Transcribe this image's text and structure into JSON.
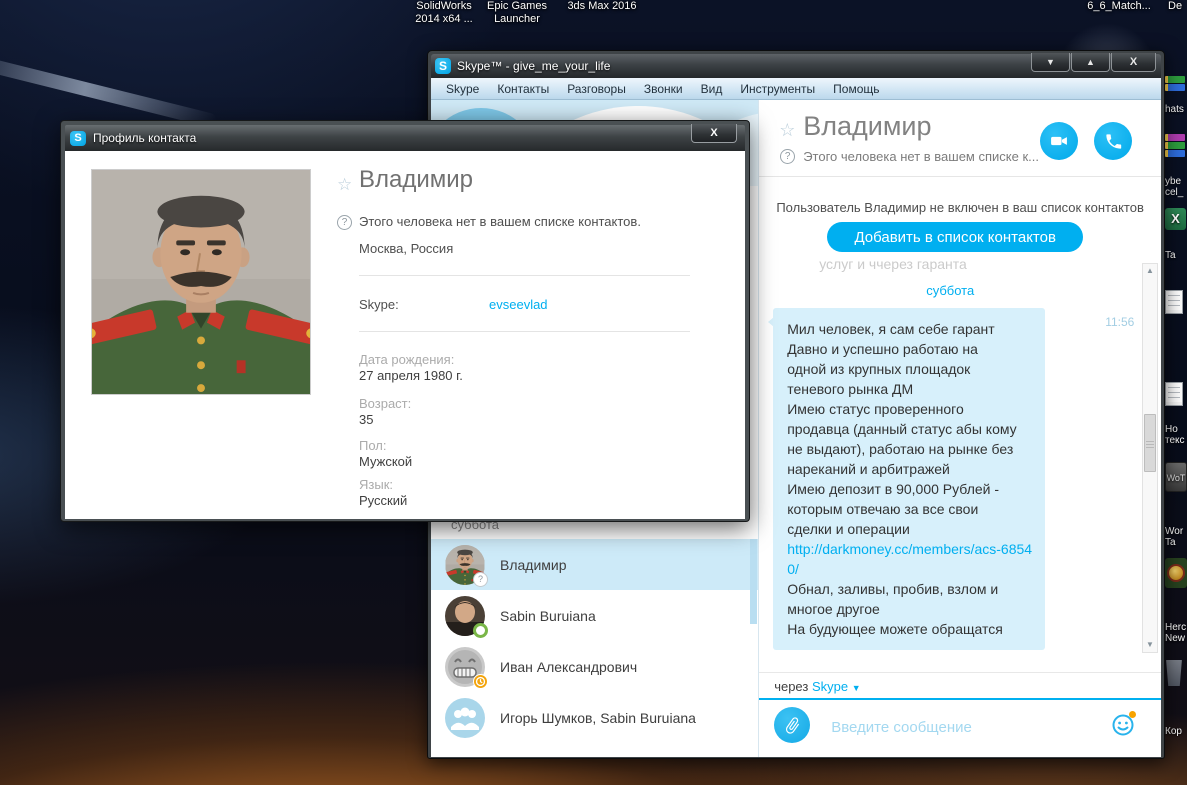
{
  "colors": {
    "skype_blue": "#00aff0",
    "bubble_bg": "#d7f0fb",
    "selected_row": "#cdeaf8",
    "accent_orange": "#f7a300"
  },
  "desktop": {
    "top_labels": [
      "SolidWorks 2014 x64 ...",
      "Epic Games Launcher",
      "3ds Max 2016",
      "6_6_Match...",
      "De"
    ],
    "right_labels": [
      "hats",
      "ybe cel_",
      "Ta",
      "Но текс",
      "Wor Ta",
      "Herc New",
      "Кор"
    ]
  },
  "window": {
    "title": "Skype™ - give_me_your_life",
    "controls": {
      "minimize": "▼",
      "maximize": "▲",
      "close": "X"
    },
    "menu": [
      "Skype",
      "Контакты",
      "Разговоры",
      "Звонки",
      "Вид",
      "Инструменты",
      "Помощь"
    ]
  },
  "sidebar": {
    "date_header": "суббота",
    "contacts": [
      {
        "name": "Владимир",
        "status": "unknown"
      },
      {
        "name": "Sabin Buruiana",
        "status": "online"
      },
      {
        "name": "Иван Александрович",
        "status": "away"
      },
      {
        "name": "Игорь Шумков, Sabin Buruiana",
        "status": "group"
      }
    ]
  },
  "chat": {
    "header": {
      "name": "Владимир",
      "status": "Этого человека нет в вашем списке к..."
    },
    "notice": "Пользователь Владимир не включен в ваш список контактов",
    "add_button": "Добавить в список контактов",
    "scrollback_fragment": "услуг и ччерез гаранта",
    "date_divider": "суббота",
    "message": {
      "time": "11:56",
      "part1": "Мил человек, я сам себе гарант\nДавно и успешно работаю на\nодной из крупных площадок\nтеневого рынка ДМ\nИмею статус проверенного\nпродавца (данный статус абы кому\nне выдают), работаю на рынке без\nнареканий и арбитражей\nИмею депозит в 90,000 Рублей -\nкоторым отвечаю за все свои\nсделки и операции",
      "link": "http://darkmoney.cc/members/acs-68540/",
      "part2": "Обнал, заливы, пробив, взлом и\nмногое другое\nНа будующее можете обращатся"
    },
    "via_label": "через",
    "via_value": "Skype",
    "via_caret": "▼",
    "input_placeholder": "Введите сообщение"
  },
  "dialog": {
    "title": "Профиль контакта",
    "close": "X",
    "name": "Владимир",
    "not_in_list": "Этого человека нет в вашем списке контактов.",
    "location": "Москва, Россия",
    "skype_label": "Skype:",
    "skype_value": "evseevlad",
    "fields": [
      {
        "label": "Дата рождения:",
        "value": "27 апреля 1980 г."
      },
      {
        "label": "Возраст:",
        "value": "35"
      },
      {
        "label": "Пол:",
        "value": "Мужской"
      },
      {
        "label": "Язык:",
        "value": "Русский"
      }
    ]
  }
}
